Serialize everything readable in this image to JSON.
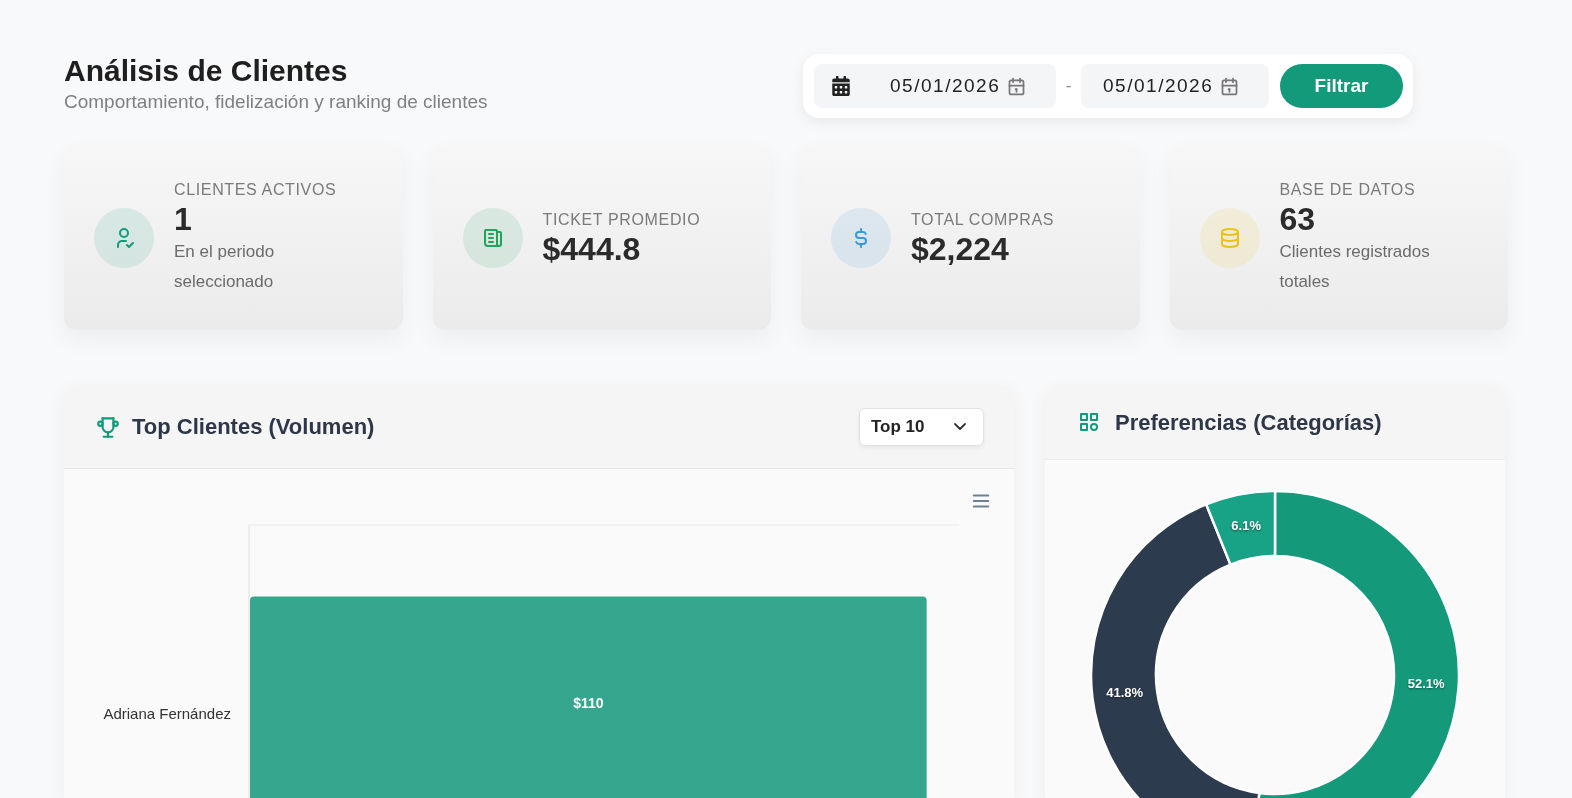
{
  "header": {
    "title": "Análisis de Clientes",
    "subtitle": "Comportamiento, fidelización y ranking de clientes"
  },
  "date_filter": {
    "start": "05/01/2026",
    "separator": "-",
    "end": "05/01/2026",
    "button": "Filtrar"
  },
  "stats": [
    {
      "kind": "users",
      "color": "#139a7a",
      "label": "CLIENTES ACTIVOS",
      "value": "1",
      "description": "En el periodo seleccionado"
    },
    {
      "kind": "ticket",
      "color": "#22a35a",
      "label": "TICKET PROMEDIO",
      "value": "$444.8"
    },
    {
      "kind": "money",
      "color": "#3b98d8",
      "label": "TOTAL COMPRAS",
      "value": "$2,224"
    },
    {
      "kind": "database",
      "color": "#eac31a",
      "label": "BASE DE DATOS",
      "value": "63",
      "description": "Clientes registrados totales"
    }
  ],
  "top_clients": {
    "title": "Top Clientes (Volumen)",
    "select": "Top 10",
    "bars": [
      {
        "client": "Adriana Fernández",
        "amount": "$110"
      }
    ]
  },
  "preferences": {
    "title": "Preferencias (Categorías)",
    "chart_data": {
      "type": "donut",
      "series": [
        {
          "values": [
            52.1,
            41.8,
            6.1
          ]
        }
      ],
      "colors": [
        "#149a7b",
        "#2d3b4e",
        "#18a386"
      ],
      "value_labels": [
        "52.1%",
        "41.8%",
        "6.1%"
      ]
    }
  }
}
